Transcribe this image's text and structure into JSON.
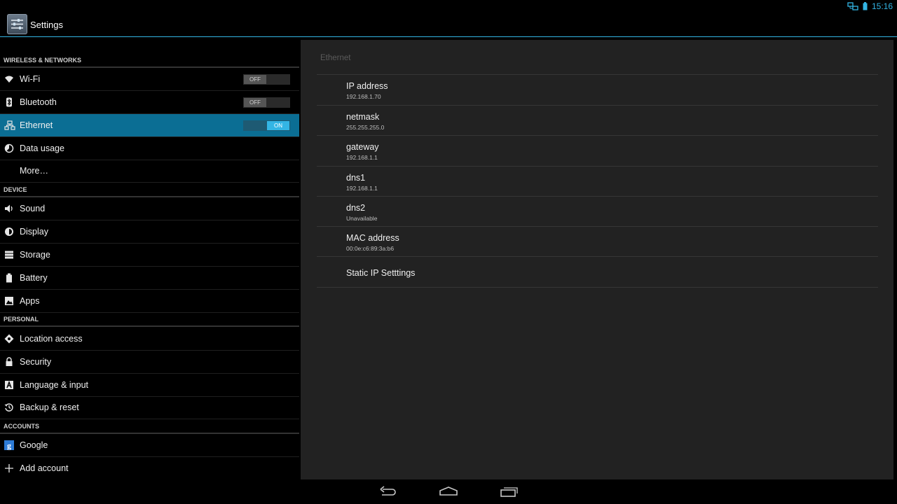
{
  "status": {
    "time": "15:16"
  },
  "actionbar": {
    "title": "Settings",
    "icon": "settings-app-icon"
  },
  "sections": {
    "wireless": "WIRELESS & NETWORKS",
    "device": "DEVICE",
    "personal": "PERSONAL",
    "accounts": "ACCOUNTS"
  },
  "items": {
    "wifi": {
      "label": "Wi-Fi",
      "toggle": "OFF",
      "icon": "wifi-icon"
    },
    "bluetooth": {
      "label": "Bluetooth",
      "toggle": "OFF",
      "icon": "bluetooth-icon"
    },
    "ethernet": {
      "label": "Ethernet",
      "toggle": "ON",
      "icon": "ethernet-icon"
    },
    "data_usage": {
      "label": "Data usage",
      "icon": "data-usage-icon"
    },
    "more": {
      "label": "More…"
    },
    "sound": {
      "label": "Sound",
      "icon": "sound-icon"
    },
    "display": {
      "label": "Display",
      "icon": "display-icon"
    },
    "storage": {
      "label": "Storage",
      "icon": "storage-icon"
    },
    "battery": {
      "label": "Battery",
      "icon": "battery-icon"
    },
    "apps": {
      "label": "Apps",
      "icon": "apps-icon"
    },
    "location": {
      "label": "Location access",
      "icon": "location-icon"
    },
    "security": {
      "label": "Security",
      "icon": "lock-icon"
    },
    "language": {
      "label": "Language & input",
      "icon": "language-icon"
    },
    "backup": {
      "label": "Backup & reset",
      "icon": "backup-icon"
    },
    "google": {
      "label": "Google",
      "icon": "google-icon"
    },
    "add_account": {
      "label": "Add account",
      "icon": "plus-icon"
    }
  },
  "ethernet_pane": {
    "title": "Ethernet",
    "rows": [
      {
        "title": "IP address",
        "value": "192.168.1.70"
      },
      {
        "title": "netmask",
        "value": "255.255.255.0"
      },
      {
        "title": "gateway",
        "value": "192.168.1.1"
      },
      {
        "title": "dns1",
        "value": "192.168.1.1"
      },
      {
        "title": "dns2",
        "value": "Unavailable"
      },
      {
        "title": "MAC address",
        "value": "00:0e:c6:89:3a:b6"
      }
    ],
    "static_ip": "Static IP Setttings"
  },
  "colors": {
    "accent": "#33b5e5",
    "selected": "#0b6e94",
    "pane": "#222222"
  }
}
